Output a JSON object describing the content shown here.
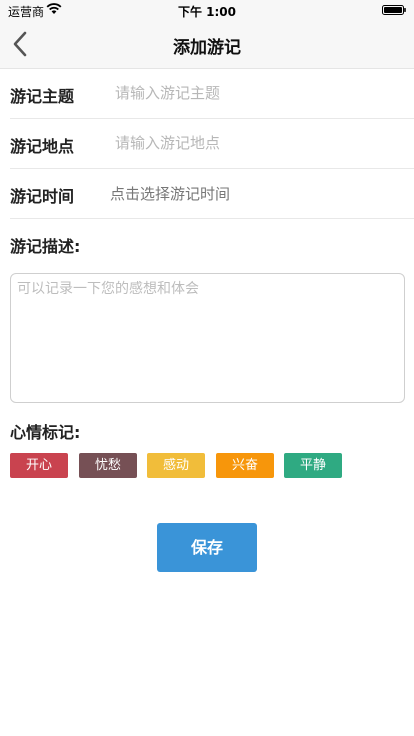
{
  "status_bar": {
    "carrier": "运营商",
    "time": "下午 1:00"
  },
  "nav": {
    "title": "添加游记",
    "back_icon": "chevron-left-icon"
  },
  "form": {
    "topic": {
      "label": "游记主题",
      "placeholder": "请输入游记主题",
      "value": ""
    },
    "location": {
      "label": "游记地点",
      "placeholder": "请输入游记地点",
      "value": ""
    },
    "time": {
      "label": "游记时间",
      "picker_text": "点击选择游记时间"
    },
    "description": {
      "label": "游记描述:",
      "placeholder": "可以记录一下您的感想和体会",
      "value": ""
    }
  },
  "mood": {
    "label": "心情标记:",
    "tags": [
      {
        "label": "开心",
        "color": "#c9434f"
      },
      {
        "label": "忧愁",
        "color": "#765055"
      },
      {
        "label": "感动",
        "color": "#f1bd3a"
      },
      {
        "label": "兴奋",
        "color": "#f7960b"
      },
      {
        "label": "平静",
        "color": "#2faa82"
      }
    ]
  },
  "save_button": {
    "label": "保存",
    "color": "#3a94d8"
  }
}
